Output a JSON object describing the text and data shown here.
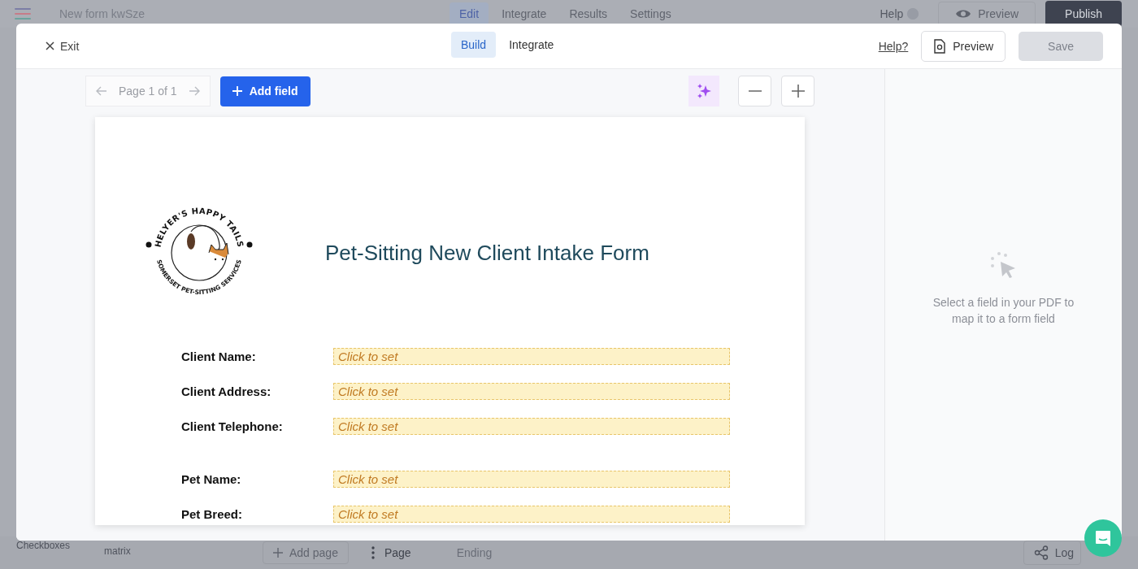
{
  "background": {
    "title": "New form kwSze",
    "tabs": [
      {
        "label": "Edit",
        "selected": true
      },
      {
        "label": "Integrate",
        "selected": false
      },
      {
        "label": "Results",
        "selected": false
      },
      {
        "label": "Settings",
        "selected": false
      }
    ],
    "help": "Help",
    "preview": "Preview",
    "publish": "Publish",
    "bottom": {
      "checkboxes": "Checkboxes",
      "matrix": "matrix",
      "add_page": "Add page",
      "page": "Page",
      "ending": "Ending",
      "logic": "Log"
    }
  },
  "modal": {
    "exit": "Exit",
    "tabs": [
      {
        "label": "Build",
        "selected": true
      },
      {
        "label": "Integrate",
        "selected": false
      }
    ],
    "help_link": "Help?",
    "preview": "Preview",
    "save": {
      "label": "Save",
      "disabled": true
    },
    "pager": "Page 1 of 1",
    "add_field": "Add field",
    "pdf": {
      "logo": {
        "top_text": "HELYER'S HAPPY TAILS",
        "bottom_text": "SOMERSET PET-SITTING SERVICES"
      },
      "title": "Pet-Sitting New Client Intake Form",
      "client_fields": [
        {
          "label": "Client Name:",
          "value": "Click to set"
        },
        {
          "label": "Client Address:",
          "value": "Click to set"
        },
        {
          "label": "Client Telephone:",
          "value": "Click to set"
        }
      ],
      "pet_fields": [
        {
          "label": "Pet Name:",
          "value": "Click to set"
        },
        {
          "label": "Pet Breed:",
          "value": "Click to set"
        }
      ]
    },
    "panel_message": "Select a field in your PDF to map it to a form field"
  }
}
